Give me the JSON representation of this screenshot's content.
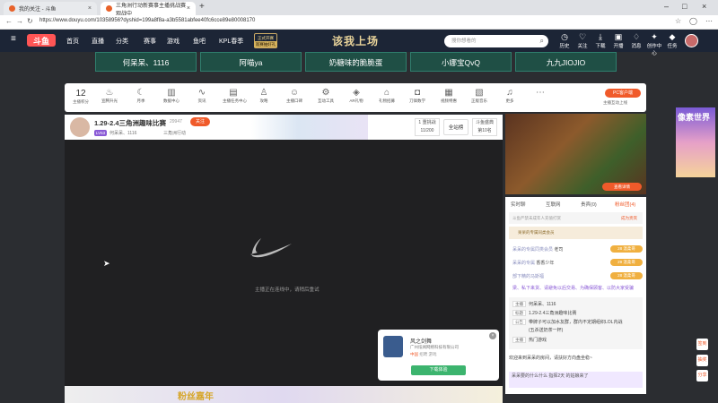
{
  "browser": {
    "tabs": [
      {
        "label": "我的关注 - 斗鱼"
      },
      {
        "label": "三角洲行动新赛事主播挑战赛观战中"
      }
    ],
    "url": "https://www.douyu.com/10358956?dyshid=199a8f8a-a3b5581abfee40fc6cce89e80008170"
  },
  "header": {
    "logo": "斗鱼",
    "nav": [
      "首页",
      "直播",
      "分类",
      "赛事",
      "游戏",
      "鱼吧",
      "KPL春季"
    ],
    "promo_top": "正式开赛",
    "promo_bottom": "观赛抽好礼",
    "banner_text": "该我上场",
    "search_placeholder": "搜你想看的",
    "icons": [
      "历史",
      "关注",
      "下载",
      "开播",
      "消息",
      "创作中心",
      "任务"
    ]
  },
  "teams": [
    "何呆呆、1116",
    "阿喵ya",
    "奶糖味的脆脆蛋",
    "小娜宝QvQ",
    "九九JIOJIO"
  ],
  "toolbar": {
    "fans_count": "12",
    "fans_label": "主播积分",
    "items": [
      "宣腾升光",
      "月季",
      "数据中心",
      "资讯",
      "主播任务中心",
      "攻略",
      "主播口碑",
      "互动工具",
      "AR礼物",
      "礼物招募",
      "刀锋数学",
      "视频特惠",
      "正版音乐",
      "更多"
    ],
    "pc_button": "PC客户端",
    "pc_note": "主播互动上线"
  },
  "player": {
    "title": "1.29-2.4三角洲趣味比赛",
    "viewers": "29947",
    "follow": "关注",
    "level": "LV53",
    "name": "何呆呆、1116",
    "category": "三角洲行动",
    "box1_top": "1 重挑战",
    "box1_bottom": "11/200",
    "box2": "全站榜",
    "box3_top": "斗鱼盛典",
    "box3_bottom": "第10名",
    "offline_text": "主播正在连线中，请稍后重试"
  },
  "popup": {
    "game_name": "风之剑舞",
    "company": "广州炫闻网络科技有限公司",
    "tags": [
      "中国",
      "招聘",
      "游戏"
    ],
    "button": "下载体验",
    "close": "×"
  },
  "gift_banner": "粉丝嘉年",
  "thumbnail": {
    "button": "查看详情"
  },
  "chat": {
    "tabs": [
      "实时聊",
      "互联网",
      "贵宾(0)",
      "粉丝团(4)"
    ],
    "rule": "斗鱼严禁未成年人充值打赏",
    "rule_action": "成为贵宾",
    "rank_text": "呆呆的专属同类会员",
    "messages": [
      {
        "name": "呆呆的专属同类会员",
        "text": "老司"
      },
      {
        "name": "呆呆的专属",
        "text": "香香少年"
      },
      {
        "name": "部下精的马斯福",
        "text": ""
      }
    ],
    "badges": [
      "28 温柔哥",
      "29 温柔哥",
      "28 温柔哥"
    ],
    "long_text": "梁、私下来货、请避免以后交易、为确保顾客、以防大家受骗",
    "info": [
      {
        "k": "主播",
        "v": "何呆呆、1116"
      },
      {
        "k": "标题",
        "v": "1.29-2.4三角洲趣味比赛"
      },
      {
        "k": "公告",
        "v": "带牌子可以加水友群，群内不定期组织LOL内战"
      },
      {
        "k": "",
        "v": "(五杀送奶茶一杯)"
      },
      {
        "k": "主播",
        "v": "热门游戏"
      }
    ],
    "welcome": "欢迎来到呆呆的房间，请扶好方向盘坐稳~",
    "last_msg": "呆呆要的什么什么 指挥2天 的姑娘来了"
  },
  "side": {
    "event_text": "像素世界",
    "buttons": [
      "签到",
      "抽奖",
      "分享"
    ]
  }
}
